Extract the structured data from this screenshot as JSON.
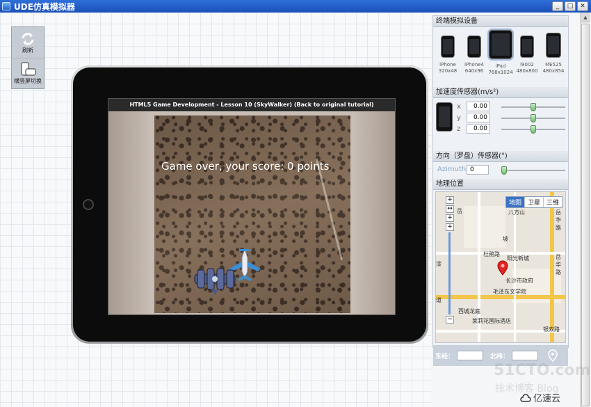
{
  "window": {
    "title": "UDE仿真模拟器",
    "min_label": "_",
    "max_label": "□",
    "close_label": "✕"
  },
  "toolbox": {
    "refresh_label": "刷新",
    "rotate_label": "横竖屏切换"
  },
  "emulator": {
    "page_header": "HTML5 Game Development - Lesson 10 (SkyWalker) (Back to original tutorial)",
    "game_message": "Game over, your score: 0 points"
  },
  "panel": {
    "devices_title": "终端模拟设备",
    "devices": [
      {
        "name": "iPhone",
        "res": "320x48"
      },
      {
        "name": "iPhone4",
        "res": "640x96"
      },
      {
        "name": "iPad",
        "res": "768x1024"
      },
      {
        "name": "i9002",
        "res": "480x800"
      },
      {
        "name": "ME525",
        "res": "480x854"
      }
    ],
    "accel_title": "加速度传感器(m/s²)",
    "accel": {
      "x_label": "x",
      "x_value": "0.00",
      "y_label": "y",
      "y_value": "0.00",
      "z_label": "z",
      "z_value": "0.00"
    },
    "orientation_title": "方向（罗盘）传感器(°)",
    "azimuth_label": "Azimuth",
    "azimuth_value": "0",
    "location_title": "地理位置",
    "map": {
      "tabs": [
        "地图",
        "卫星",
        "三维"
      ],
      "labels": [
        "岳",
        "八方山",
        "岳华路",
        "坡",
        "杜鹃路",
        "阳光新城",
        "长沙市政府",
        "毛泽东文学院",
        "岳华路",
        "西城龙庭",
        "莱莉花国际酒店",
        "银双路",
        "漆",
        "道"
      ]
    },
    "lng_label": "东经：",
    "lat_label": "北纬："
  },
  "watermark": {
    "line1": "51CTO.com",
    "line2": "技术博客  Blog"
  },
  "brand": {
    "name": "亿速云"
  }
}
